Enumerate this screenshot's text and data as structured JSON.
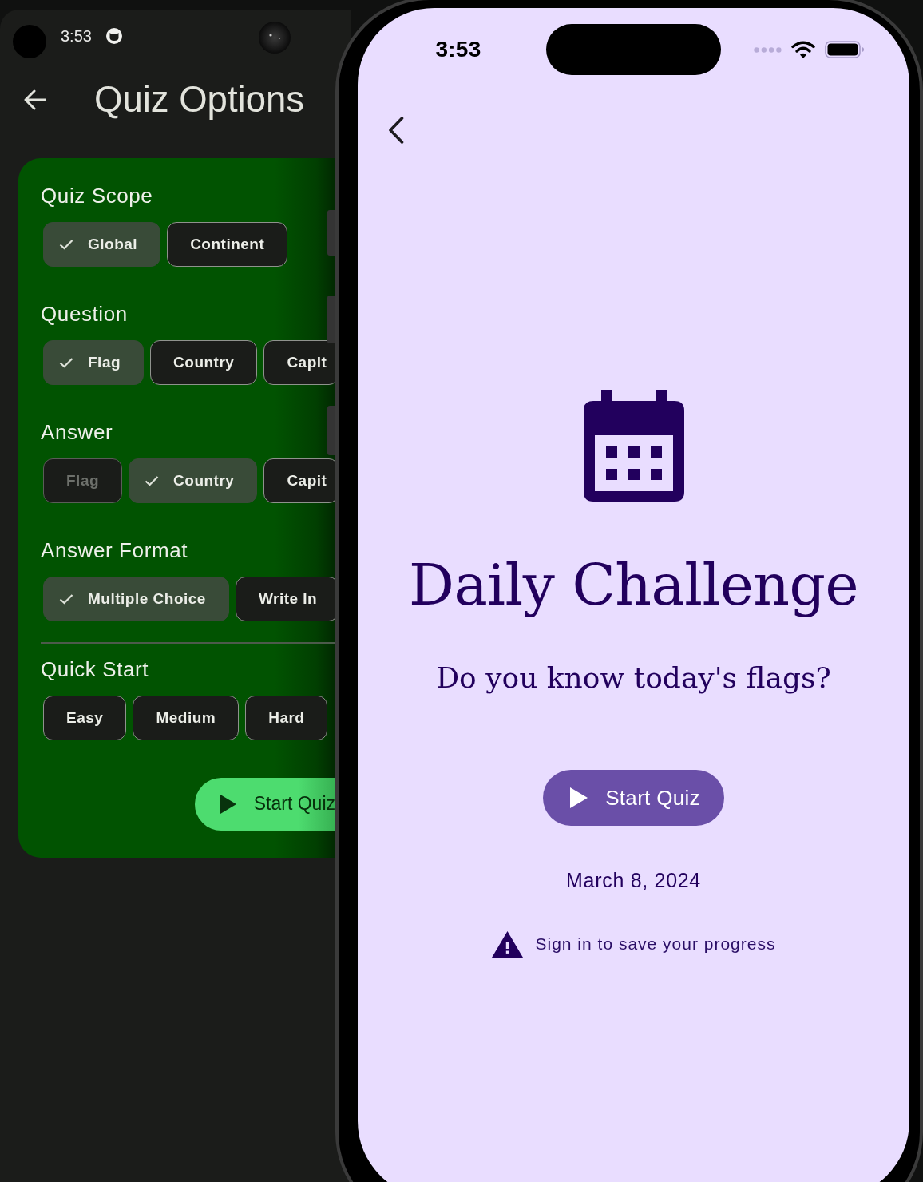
{
  "left_screen": {
    "status_bar": {
      "time": "3:53"
    },
    "app_bar": {
      "title": "Quiz Options"
    },
    "option_groups": [
      {
        "title": "Quiz Scope",
        "chips": [
          {
            "label": "Global",
            "selected": true,
            "disabled": false
          },
          {
            "label": "Continent",
            "selected": false,
            "disabled": false
          }
        ]
      },
      {
        "title": "Question",
        "chips": [
          {
            "label": "Flag",
            "selected": true,
            "disabled": false
          },
          {
            "label": "Country",
            "selected": false,
            "disabled": false
          },
          {
            "label": "Capit",
            "selected": false,
            "disabled": false
          }
        ]
      },
      {
        "title": "Answer",
        "chips": [
          {
            "label": "Flag",
            "selected": false,
            "disabled": true
          },
          {
            "label": "Country",
            "selected": true,
            "disabled": false
          },
          {
            "label": "Capit",
            "selected": false,
            "disabled": false
          }
        ]
      },
      {
        "title": "Answer Format",
        "chips": [
          {
            "label": "Multiple Choice",
            "selected": true,
            "disabled": false
          },
          {
            "label": "Write In",
            "selected": false,
            "disabled": false
          }
        ]
      }
    ],
    "quick_start": {
      "title": "Quick Start",
      "buttons": [
        "Easy",
        "Medium",
        "Hard"
      ]
    },
    "start_button": {
      "label": "Start Quiz"
    }
  },
  "right_screen": {
    "status_bar": {
      "time": "3:53"
    },
    "title": "Daily Challenge",
    "subtitle": "Do you know today's flags?",
    "start_button": {
      "label": "Start Quiz"
    },
    "date": "March 8, 2024",
    "notice": "Sign in to save your progress"
  }
}
